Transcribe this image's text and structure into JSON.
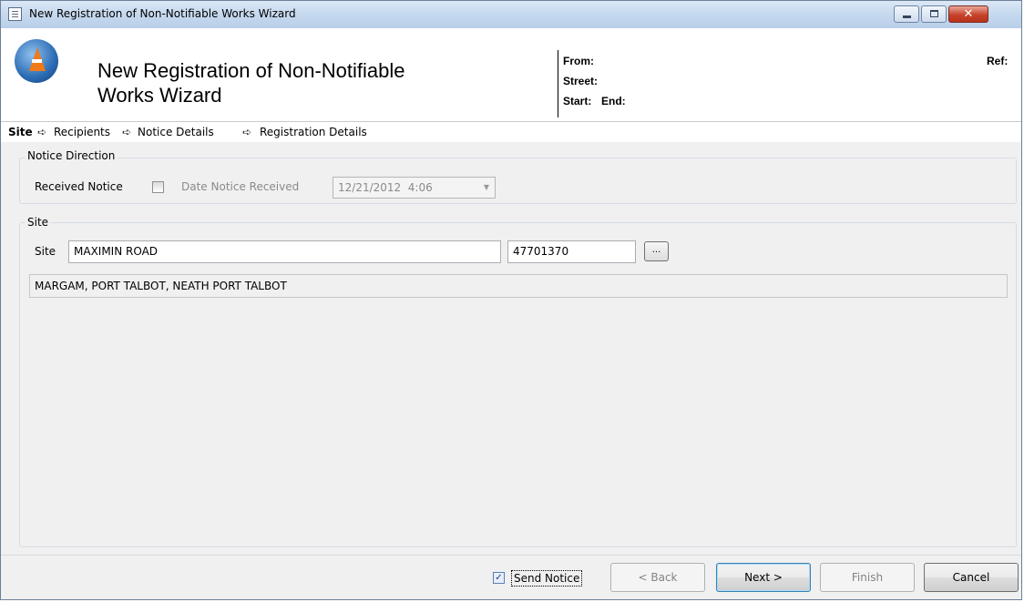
{
  "window": {
    "title": "New Registration of Non-Notifiable Works Wizard"
  },
  "header": {
    "title_line1": "New Registration of Non-Notifiable",
    "title_line2": "Works Wizard",
    "from_label": "From:",
    "street_label": "Street:",
    "start_label": "Start:",
    "end_label": "End:",
    "ref_label": "Ref:"
  },
  "steps": [
    "Site",
    "Recipients",
    "Notice Details",
    "Registration Details"
  ],
  "step_arrow": "➪",
  "notice_direction": {
    "group_label": "Notice Direction",
    "received_label": "Received Notice",
    "received_checked": false,
    "date_label": "Date Notice Received",
    "date_value": "12/21/2012  4:06"
  },
  "site": {
    "group_label": "Site",
    "field_label": "Site",
    "street_value": "MAXIMIN ROAD",
    "usrn_value": "47701370",
    "browse_label": "...",
    "locality_value": "MARGAM, PORT TALBOT, NEATH PORT TALBOT"
  },
  "footer": {
    "send_notice_label": "Send Notice",
    "send_notice_checked": true,
    "back_label": "< Back",
    "next_label": "Next >",
    "finish_label": "Finish",
    "cancel_label": "Cancel"
  }
}
